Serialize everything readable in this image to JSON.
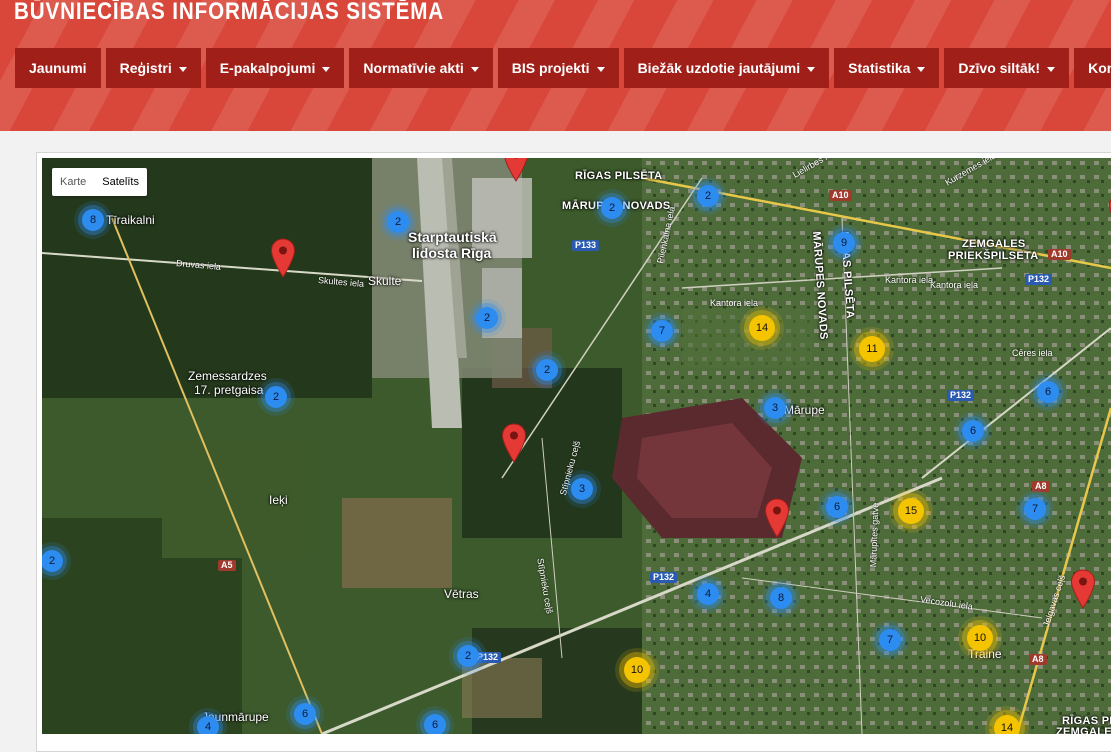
{
  "site": {
    "title": "BŪVNIECĪBAS INFORMĀCIJAS SISTĒMA"
  },
  "nav": [
    {
      "label": "Jaunumi",
      "dropdown": false
    },
    {
      "label": "Reģistri",
      "dropdown": true
    },
    {
      "label": "E-pakalpojumi",
      "dropdown": true
    },
    {
      "label": "Normatīvie akti",
      "dropdown": true
    },
    {
      "label": "BIS projekti",
      "dropdown": true
    },
    {
      "label": "Biežāk uzdotie jautājumi",
      "dropdown": true
    },
    {
      "label": "Statistika",
      "dropdown": true
    },
    {
      "label": "Dzīvo siltāk!",
      "dropdown": true
    },
    {
      "label": "Kontakti",
      "dropdown": true
    }
  ],
  "map": {
    "type_control": {
      "map_label": "Karte",
      "satellite_label": "Satelīts",
      "selected": "satellite"
    },
    "place_labels": {
      "airport_line1": "Starptautiskā",
      "airport_line2": "lidosta Rīga",
      "riga_city": "RĪGAS PILSĒTA",
      "marupes_novads": "MĀRUPES NOVADS",
      "marupes_novads_vertical": "MĀRUPES NOVADS",
      "rigas_pilseta_vertical": "RĪGAS PILSĒTA",
      "zemgales_line1": "ZEMGALES",
      "zemgales_line2": "PRIEKŠPILSĒTA",
      "skulte": "Skulte",
      "zemessardzes_line1": "Zemessardzes",
      "zemessardzes_line2": "17. pretgaisa",
      "iceki": "Ieķi",
      "vetras": "Vētras",
      "marupe": "Mārupe",
      "traine": "Traine",
      "tiraikalni": "Tīraikalni",
      "jaunmarupe": "Jaunmārupe",
      "rigas_pilseta_bottom1": "RĪGAS PILS",
      "rigas_pilseta_bottom2": "ZEMGALES P"
    },
    "roads": {
      "druvas": "Druvas iela",
      "skultes": "Skultes iela",
      "kantora1": "Kantora iela",
      "kantora2": "Kantora iela",
      "kantora3": "Kantora iela",
      "ceres": "Cēres iela",
      "vecozolu": "Vecozolu iela",
      "stipnieku1": "Stīpnieku ceļš",
      "stipnieku2": "Stīpnieku ceļš",
      "pilenkalna": "Pilenkalna iela",
      "marupites": "Mārupītes gatve",
      "jelgavas": "Jelgavas ceļš",
      "lielirbes": "Lielirbes iela",
      "kurzemes": "Kurzemes iela"
    },
    "shields": {
      "p133": "P133",
      "a10a": "A10",
      "a10b": "A10",
      "p132a": "P132",
      "p132b": "P132",
      "p132c": "P132",
      "p132d": "P132",
      "a5": "A5",
      "a8a": "A8",
      "a8b": "A8"
    },
    "clusters": [
      {
        "count": "8",
        "color": "blue"
      },
      {
        "count": "2",
        "color": "blue"
      },
      {
        "count": "2",
        "color": "blue"
      },
      {
        "count": "2",
        "color": "blue"
      },
      {
        "count": "9",
        "color": "blue"
      },
      {
        "count": "2",
        "color": "blue"
      },
      {
        "count": "7",
        "color": "blue"
      },
      {
        "count": "14",
        "color": "yellow"
      },
      {
        "count": "11",
        "color": "yellow"
      },
      {
        "count": "2",
        "color": "blue"
      },
      {
        "count": "2",
        "color": "blue"
      },
      {
        "count": "3",
        "color": "blue"
      },
      {
        "count": "6",
        "color": "blue"
      },
      {
        "count": "6",
        "color": "blue"
      },
      {
        "count": "3",
        "color": "blue"
      },
      {
        "count": "6",
        "color": "blue"
      },
      {
        "count": "15",
        "color": "yellow"
      },
      {
        "count": "7",
        "color": "blue"
      },
      {
        "count": "2",
        "color": "blue"
      },
      {
        "count": "4",
        "color": "blue"
      },
      {
        "count": "8",
        "color": "blue"
      },
      {
        "count": "7",
        "color": "blue"
      },
      {
        "count": "10",
        "color": "yellow"
      },
      {
        "count": "2",
        "color": "blue"
      },
      {
        "count": "10",
        "color": "yellow"
      },
      {
        "count": "6",
        "color": "blue"
      },
      {
        "count": "6",
        "color": "blue"
      },
      {
        "count": "4",
        "color": "blue"
      },
      {
        "count": "14",
        "color": "yellow"
      }
    ],
    "colors": {
      "header": "#d9473a",
      "nav_button": "#a11f19",
      "cluster_blue": "#2d8cf0",
      "cluster_yellow": "#f5c400",
      "pin": "#e53935"
    }
  }
}
